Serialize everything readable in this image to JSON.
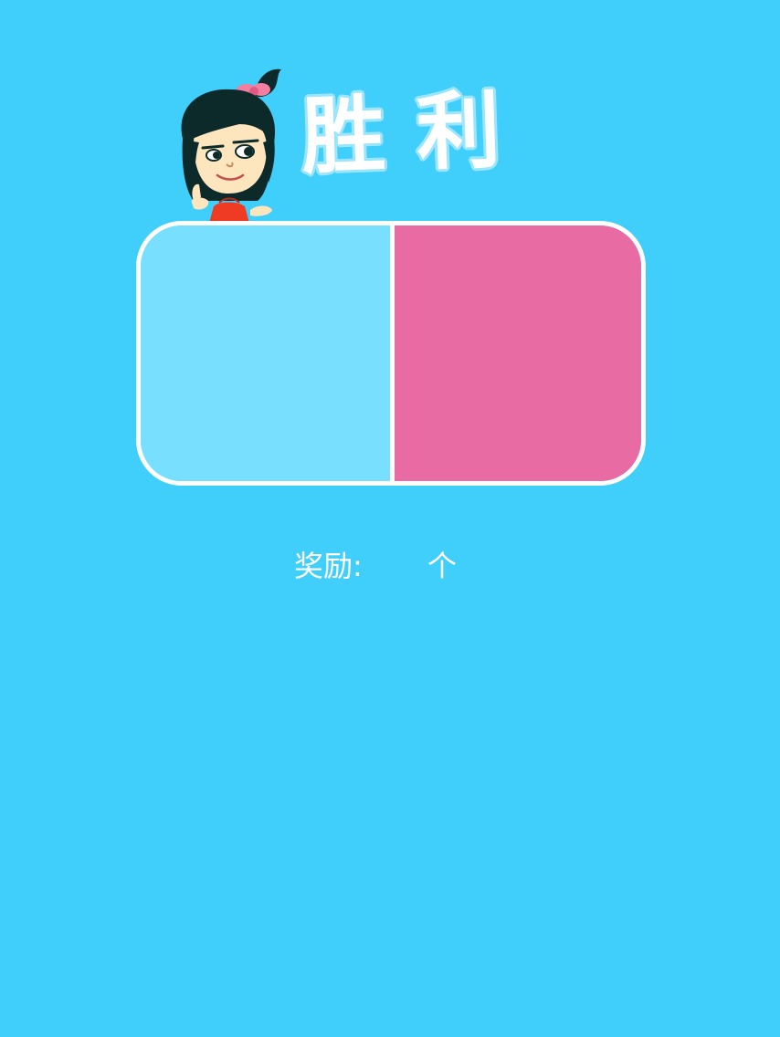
{
  "colors": {
    "background": "#40cefa",
    "left_panel": "#78e0fe",
    "right_panel": "#e96ba3",
    "border": "#ffffff",
    "text": "#ffffff"
  },
  "result": {
    "title": "胜利"
  },
  "mascot": {
    "icon": "cartoon-girl-mascot-icon"
  },
  "score_board": {
    "left_icon": "blue-team-panel",
    "right_icon": "pink-team-panel"
  },
  "reward": {
    "label": "奖励:",
    "value": "",
    "unit": "个"
  }
}
